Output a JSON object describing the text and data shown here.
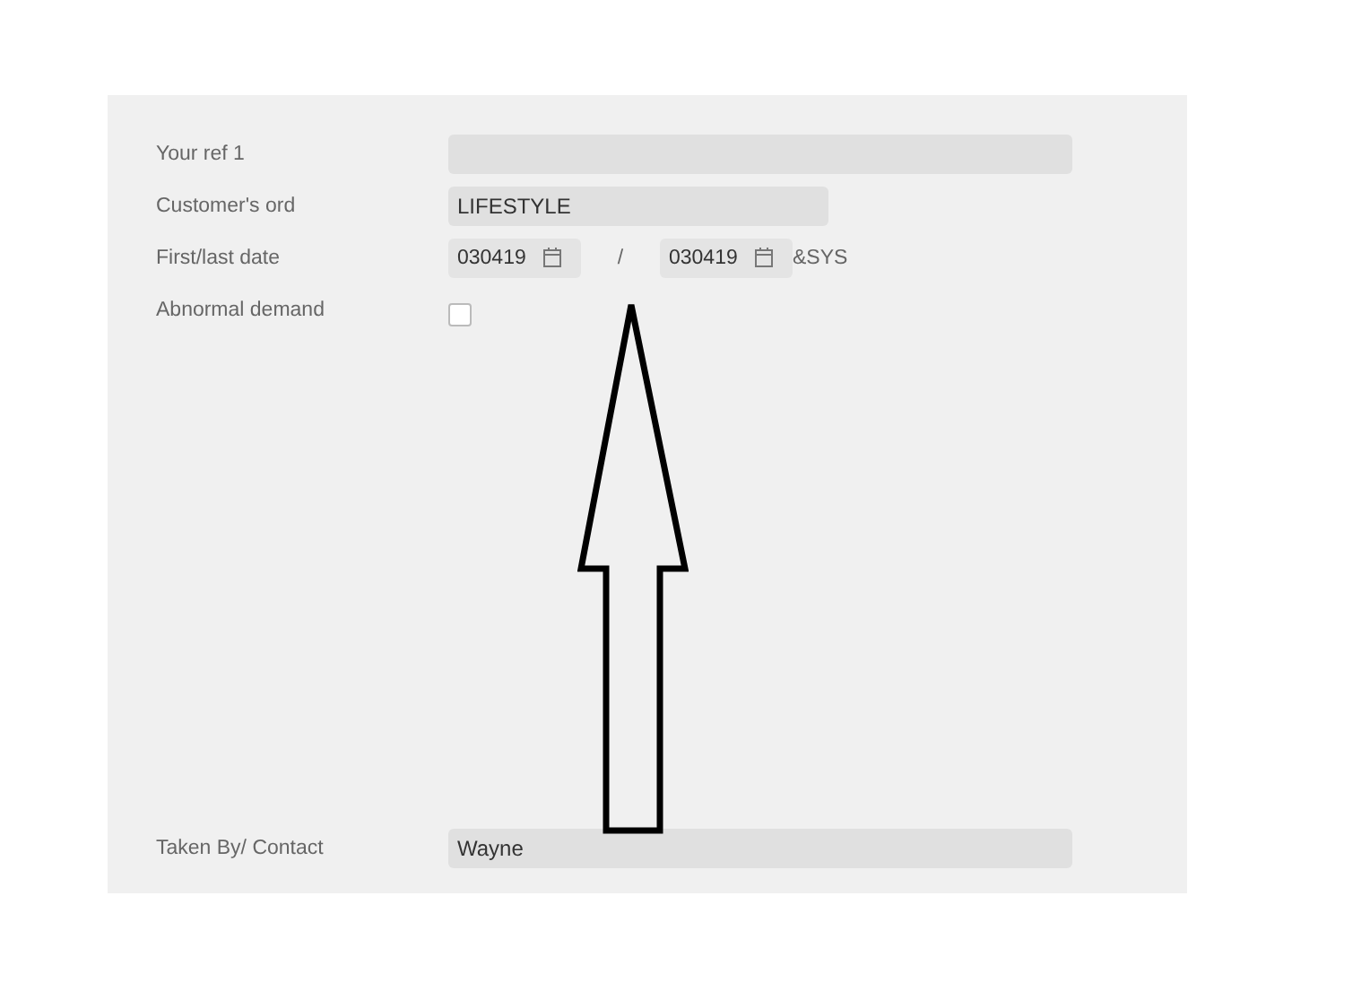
{
  "form": {
    "fields": [
      {
        "kind": "text",
        "label": "Your ref 1"
      },
      {
        "kind": "short",
        "label": "Customer's ord",
        "value": "LIFESTYLE"
      },
      {
        "kind": "daterange",
        "label": "First/last date",
        "first": "030419",
        "separator": "/",
        "last": "030419",
        "suffix": "&SYS"
      },
      {
        "kind": "checkbox",
        "label": "Abnormal demand",
        "checked": false
      }
    ],
    "footer": {
      "label": "Taken By/ Contact",
      "value": "Wayne"
    }
  },
  "annotation": {
    "kind": "arrow"
  }
}
